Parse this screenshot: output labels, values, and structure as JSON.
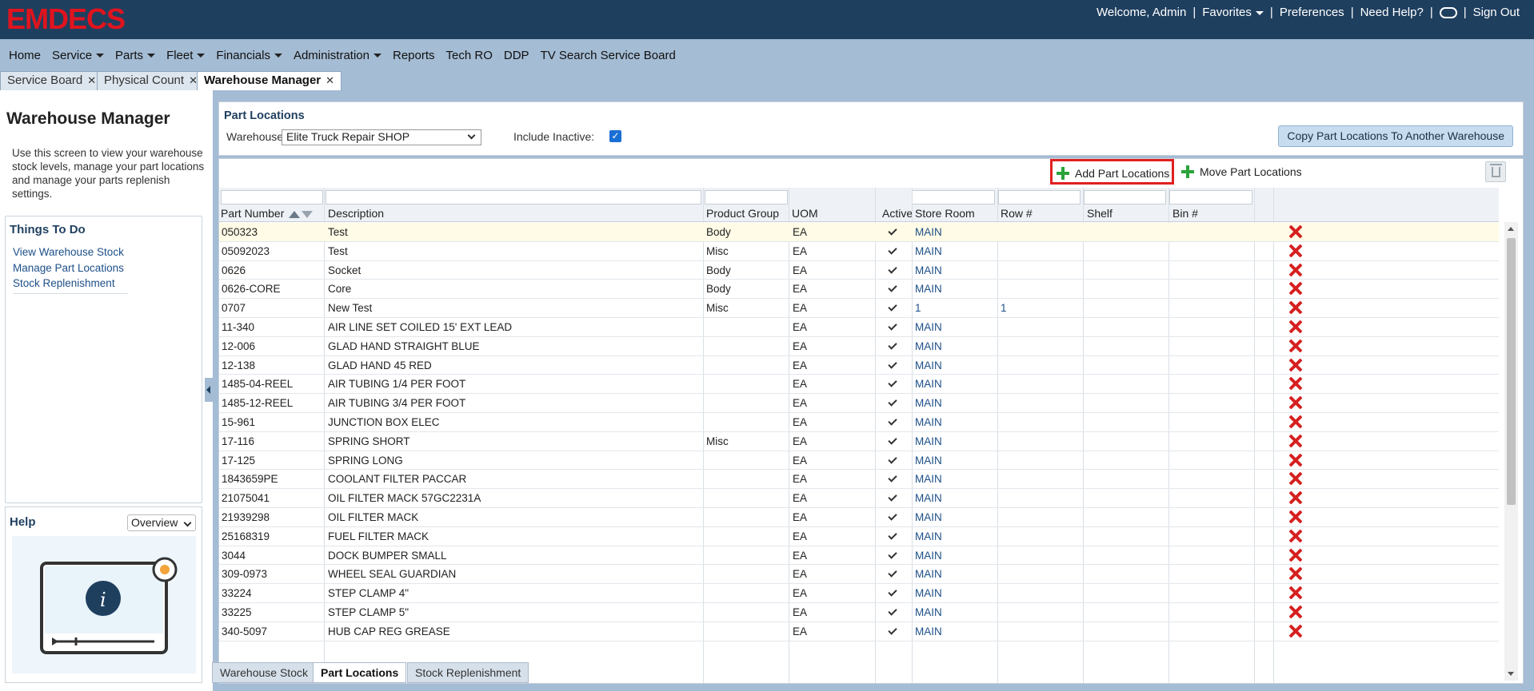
{
  "header": {
    "logo_text": "EMDECS",
    "welcome": "Welcome, Admin",
    "favorites": "Favorites",
    "preferences": "Preferences",
    "need_help": "Need Help?",
    "sign_out": "Sign Out"
  },
  "menu": [
    "Home",
    "Service",
    "Parts",
    "Fleet",
    "Financials",
    "Administration",
    "Reports",
    "Tech RO",
    "DDP",
    "TV Search Service Board"
  ],
  "tabs": [
    {
      "label": "Service Board"
    },
    {
      "label": "Physical Count"
    },
    {
      "label": "Warehouse Manager"
    }
  ],
  "left": {
    "title": "Warehouse Manager",
    "description": "Use this screen to view your warehouse stock levels, manage your part locations and manage your parts replenish settings.",
    "todo_title": "Things To Do",
    "todo_links": [
      "View Warehouse Stock",
      "Manage Part Locations",
      "Stock Replenishment"
    ],
    "help_title": "Help",
    "help_select": "Overview"
  },
  "locations": {
    "title": "Part Locations",
    "warehouse_label": "Warehouse:",
    "warehouse_value": "Elite Truck Repair SHOP",
    "include_inactive_label": "Include Inactive:",
    "copy_button": "Copy Part Locations To Another Warehouse"
  },
  "toolbar": {
    "add": "Add Part Locations",
    "move": "Move Part Locations"
  },
  "columns": [
    "Part Number",
    "Description",
    "Product Group",
    "UOM",
    "Active",
    "Store Room",
    "Row #",
    "Shelf",
    "Bin #"
  ],
  "rows": [
    {
      "part": "050323",
      "desc": "Test",
      "group": "Body",
      "uom": "EA",
      "store": "MAIN",
      "row": "",
      "shelf": "",
      "bin": ""
    },
    {
      "part": "05092023",
      "desc": "Test",
      "group": "Misc",
      "uom": "EA",
      "store": "MAIN",
      "row": "",
      "shelf": "",
      "bin": ""
    },
    {
      "part": "0626",
      "desc": "Socket",
      "group": "Body",
      "uom": "EA",
      "store": "MAIN",
      "row": "",
      "shelf": "",
      "bin": ""
    },
    {
      "part": "0626-CORE",
      "desc": "Core",
      "group": "Body",
      "uom": "EA",
      "store": "MAIN",
      "row": "",
      "shelf": "",
      "bin": ""
    },
    {
      "part": "0707",
      "desc": "New Test",
      "group": "Misc",
      "uom": "EA",
      "store": "1",
      "row": "1",
      "shelf": "",
      "bin": ""
    },
    {
      "part": "11-340",
      "desc": "AIR LINE SET COILED 15' EXT LEAD",
      "group": "",
      "uom": "EA",
      "store": "MAIN",
      "row": "",
      "shelf": "",
      "bin": ""
    },
    {
      "part": "12-006",
      "desc": "GLAD HAND STRAIGHT BLUE",
      "group": "",
      "uom": "EA",
      "store": "MAIN",
      "row": "",
      "shelf": "",
      "bin": ""
    },
    {
      "part": "12-138",
      "desc": "GLAD HAND 45 RED",
      "group": "",
      "uom": "EA",
      "store": "MAIN",
      "row": "",
      "shelf": "",
      "bin": ""
    },
    {
      "part": "1485-04-REEL",
      "desc": "AIR TUBING 1/4 PER FOOT",
      "group": "",
      "uom": "EA",
      "store": "MAIN",
      "row": "",
      "shelf": "",
      "bin": ""
    },
    {
      "part": "1485-12-REEL",
      "desc": "AIR TUBING 3/4 PER FOOT",
      "group": "",
      "uom": "EA",
      "store": "MAIN",
      "row": "",
      "shelf": "",
      "bin": ""
    },
    {
      "part": "15-961",
      "desc": "JUNCTION BOX ELEC",
      "group": "",
      "uom": "EA",
      "store": "MAIN",
      "row": "",
      "shelf": "",
      "bin": ""
    },
    {
      "part": "17-116",
      "desc": "SPRING SHORT",
      "group": "Misc",
      "uom": "EA",
      "store": "MAIN",
      "row": "",
      "shelf": "",
      "bin": ""
    },
    {
      "part": "17-125",
      "desc": "SPRING LONG",
      "group": "",
      "uom": "EA",
      "store": "MAIN",
      "row": "",
      "shelf": "",
      "bin": ""
    },
    {
      "part": "1843659PE",
      "desc": "COOLANT FILTER PACCAR",
      "group": "",
      "uom": "EA",
      "store": "MAIN",
      "row": "",
      "shelf": "",
      "bin": ""
    },
    {
      "part": "21075041",
      "desc": "OIL FILTER MACK 57GC2231A",
      "group": "",
      "uom": "EA",
      "store": "MAIN",
      "row": "",
      "shelf": "",
      "bin": ""
    },
    {
      "part": "21939298",
      "desc": "OIL FILTER MACK",
      "group": "",
      "uom": "EA",
      "store": "MAIN",
      "row": "",
      "shelf": "",
      "bin": ""
    },
    {
      "part": "25168319",
      "desc": "FUEL FILTER MACK",
      "group": "",
      "uom": "EA",
      "store": "MAIN",
      "row": "",
      "shelf": "",
      "bin": ""
    },
    {
      "part": "3044",
      "desc": "DOCK BUMPER SMALL",
      "group": "",
      "uom": "EA",
      "store": "MAIN",
      "row": "",
      "shelf": "",
      "bin": ""
    },
    {
      "part": "309-0973",
      "desc": "WHEEL SEAL GUARDIAN",
      "group": "",
      "uom": "EA",
      "store": "MAIN",
      "row": "",
      "shelf": "",
      "bin": ""
    },
    {
      "part": "33224",
      "desc": "STEP CLAMP 4\"",
      "group": "",
      "uom": "EA",
      "store": "MAIN",
      "row": "",
      "shelf": "",
      "bin": ""
    },
    {
      "part": "33225",
      "desc": "STEP CLAMP 5\"",
      "group": "",
      "uom": "EA",
      "store": "MAIN",
      "row": "",
      "shelf": "",
      "bin": ""
    },
    {
      "part": "340-5097",
      "desc": "HUB CAP REG GREASE",
      "group": "",
      "uom": "EA",
      "store": "MAIN",
      "row": "",
      "shelf": "",
      "bin": ""
    }
  ],
  "bottom_tabs": [
    "Warehouse Stock",
    "Part Locations",
    "Stock Replenishment"
  ],
  "colors": {
    "header": "#1f3f5f",
    "menu": "#a4bcd4",
    "logo": "#e0141e",
    "link": "#1d4f88",
    "delete": "#d62020",
    "highlight": "#e02020"
  }
}
